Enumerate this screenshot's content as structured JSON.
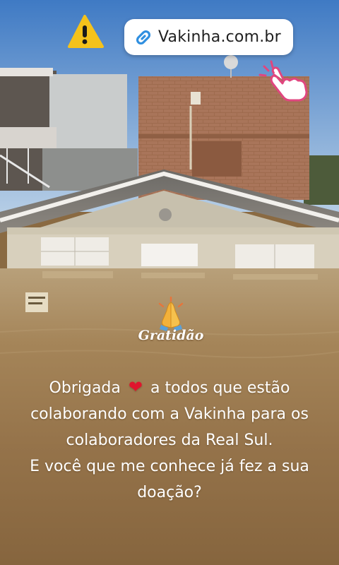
{
  "link_sticker": {
    "icon": "link-icon",
    "label": "Vakinha.com.br"
  },
  "stickers": {
    "warning": "warning-icon",
    "tap": "tap-hand-icon",
    "prayer": "praying-hands-icon"
  },
  "gratitude": {
    "label": "Gratidão"
  },
  "caption": {
    "line1_before": "Obrigada",
    "heart": "❤",
    "line1_after": "a todos que estão",
    "line2": "colaborando com a Vakinha para os",
    "line3": "colaboradores da Real Sul.",
    "line4": "E você que me conhece já fez a sua",
    "line5": "doação?"
  },
  "colors": {
    "sky": "#5b8fcb",
    "flood_water": "#8a6a42",
    "brick": "#9c6b4f",
    "heart": "#e0152d",
    "tap_pink": "#e0467f"
  }
}
